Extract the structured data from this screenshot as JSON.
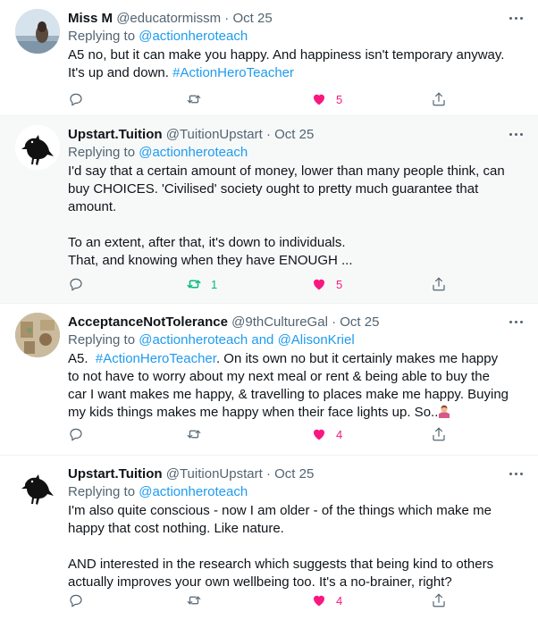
{
  "tweets": [
    {
      "name": "Miss M",
      "handle": "@educatormissm",
      "dot": "·",
      "date": "Oct 25",
      "replying_prefix": "Replying to",
      "replying_to": "@actionheroteach",
      "replying_joiner": "",
      "replying_to_2": "",
      "lines": [
        {
          "text": "A5 no, but it can make you happy. And happiness isn't temporary anyway.",
          "tag": ""
        },
        {
          "text": "It's up and down. ",
          "tag": "#ActionHeroTeacher"
        }
      ],
      "actions": {
        "reply_count": "",
        "retweet_count": "",
        "like_count": "5"
      },
      "avatar_icon": "profile-photo-icon"
    },
    {
      "name": "Upstart.Tuition",
      "handle": "@TuitionUpstart",
      "dot": "·",
      "date": "Oct 25",
      "replying_prefix": "Replying to",
      "replying_to": "@actionheroteach",
      "replying_joiner": "",
      "replying_to_2": "",
      "lines": [
        {
          "text": "I'd say that a certain amount of money, lower than many people think, can"
        },
        {
          "text": "buy CHOICES.  'Civilised' society ought to pretty much guarantee that"
        },
        {
          "text": "amount."
        },
        {
          "text": ""
        },
        {
          "text": "To an extent, after that, it's down to individuals."
        },
        {
          "text": "That, and knowing when they have ENOUGH ..."
        }
      ],
      "actions": {
        "reply_count": "",
        "retweet_count": "1",
        "like_count": "5"
      },
      "avatar_icon": "crow-icon"
    },
    {
      "name": "AcceptanceNotTolerance",
      "handle": "@9thCultureGal",
      "dot": "·",
      "date": "Oct 25",
      "replying_prefix": "Replying to",
      "replying_to": "@actionheroteach",
      "replying_joiner": "and",
      "replying_to_2": "@AlisonKriel",
      "lines": [
        {
          "text": "A5.  ",
          "tag": "#ActionHeroTeacher",
          "tail": ". On its own no but it certainly makes me happy"
        },
        {
          "text": "to not have to worry about my next meal or rent & being able to buy the"
        },
        {
          "text": "car I want makes me happy, & travelling to places make me happy. Buying"
        },
        {
          "text": "my kids things makes me happy when their face lights up. So.."
        }
      ],
      "actions": {
        "reply_count": "",
        "retweet_count": "",
        "like_count": "4"
      },
      "avatar_icon": "profile-photo-icon",
      "emoji_icon": "person-shrugging-emoji-icon"
    },
    {
      "name": "Upstart.Tuition",
      "handle": "@TuitionUpstart",
      "dot": "·",
      "date": "Oct 25",
      "replying_prefix": "Replying to",
      "replying_to": "@actionheroteach",
      "replying_joiner": "",
      "replying_to_2": "",
      "lines": [
        {
          "text": "I'm also quite conscious - now I am older - of the things which make me"
        },
        {
          "text": "happy that cost nothing.  Like nature."
        },
        {
          "text": ""
        },
        {
          "text": "AND interested in the research which suggests that being kind to others"
        },
        {
          "text": "actually improves your own wellbeing too.  It's a no-brainer, right?"
        }
      ],
      "actions": {
        "reply_count": "",
        "retweet_count": "",
        "like_count": "4"
      },
      "avatar_icon": "crow-icon"
    }
  ],
  "colors": {
    "link": "#1d9bf0",
    "like": "#f91880",
    "retweet": "#00ba7c",
    "muted": "#536471",
    "highlight_bg": "#f7f9f9"
  }
}
